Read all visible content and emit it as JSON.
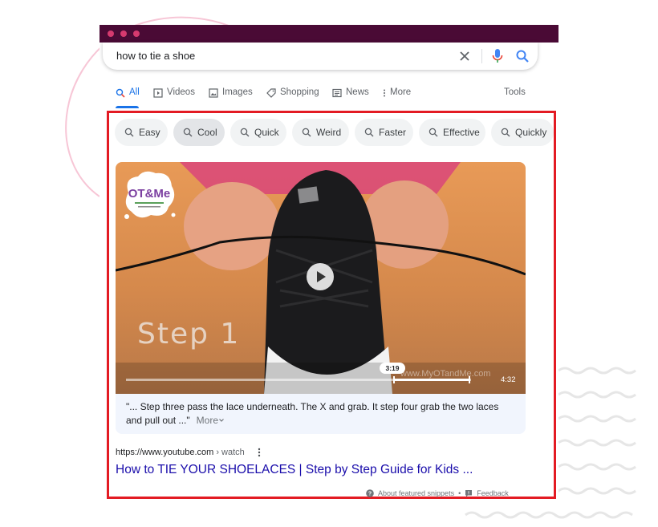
{
  "search": {
    "query": "how to tie a shoe"
  },
  "tabs": [
    {
      "label": "All",
      "icon": "search-icon",
      "active": true
    },
    {
      "label": "Videos",
      "icon": "video-icon"
    },
    {
      "label": "Images",
      "icon": "image-icon"
    },
    {
      "label": "Shopping",
      "icon": "tag-icon"
    },
    {
      "label": "News",
      "icon": "newspaper-icon"
    },
    {
      "label": "More",
      "icon": "vertical-dots-icon"
    }
  ],
  "tools_label": "Tools",
  "chips": [
    "Easy",
    "Cool",
    "Quick",
    "Weird",
    "Faster",
    "Effective",
    "Quickly"
  ],
  "video": {
    "overlay_text": "Step 1",
    "logo_text": "OT&Me",
    "watermark": "www.MyOTandMe.com",
    "current_time": "3:19",
    "duration": "4:32"
  },
  "caption": {
    "text": "\"... Step three pass the lace underneath. The X and grab. It step four grab the two laces and pull out ...\"",
    "more_label": "More"
  },
  "result": {
    "url_host": "https://www.youtube.com",
    "url_path": " › watch",
    "title": "How to TIE YOUR SHOELACES | Step by Step Guide for Kids ..."
  },
  "footer": {
    "about_label": "About featured snippets",
    "separator": "•",
    "feedback_label": "Feedback"
  },
  "colors": {
    "titlebar": "#4a0a35",
    "highlight": "#e31b23",
    "link": "#1a0dab",
    "accent": "#1a73e8"
  }
}
